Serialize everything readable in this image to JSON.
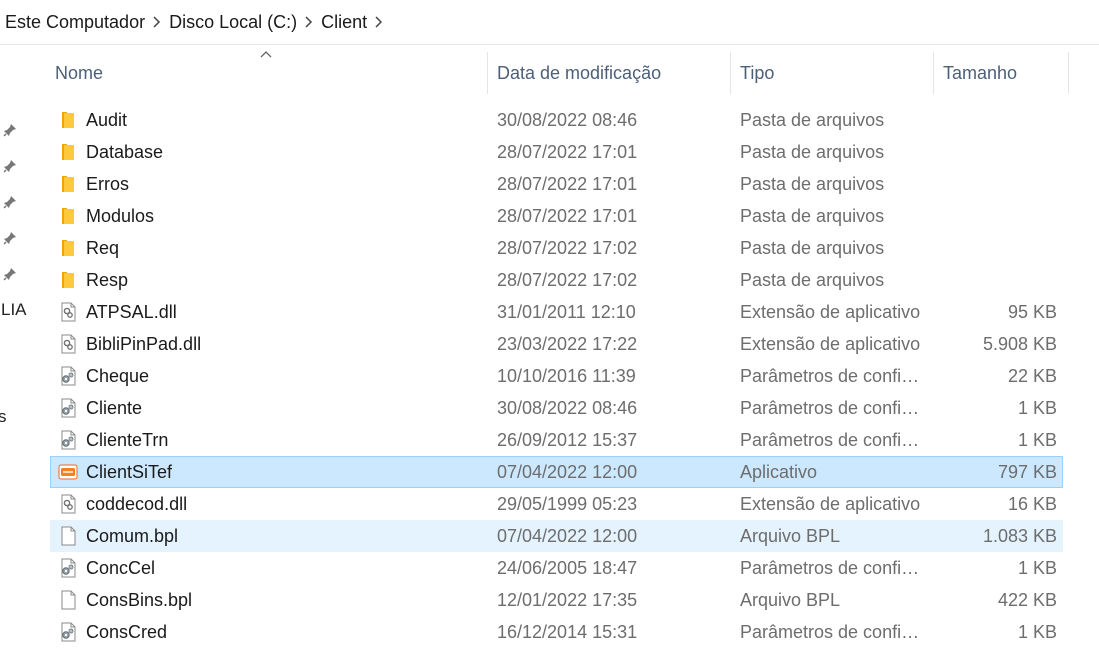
{
  "breadcrumb": [
    "Este Computador",
    "Disco Local (C:)",
    "Client"
  ],
  "left_nav": {
    "labels": [
      "LIA",
      "s"
    ]
  },
  "columns": {
    "name": "Nome",
    "date": "Data de modificação",
    "type": "Tipo",
    "size": "Tamanho"
  },
  "files": [
    {
      "name": "Audit",
      "date": "30/08/2022 08:46",
      "type": "Pasta de arquivos",
      "size": "",
      "icon": "folder-icon"
    },
    {
      "name": "Database",
      "date": "28/07/2022 17:01",
      "type": "Pasta de arquivos",
      "size": "",
      "icon": "folder-icon"
    },
    {
      "name": "Erros",
      "date": "28/07/2022 17:01",
      "type": "Pasta de arquivos",
      "size": "",
      "icon": "folder-icon"
    },
    {
      "name": "Modulos",
      "date": "28/07/2022 17:01",
      "type": "Pasta de arquivos",
      "size": "",
      "icon": "folder-icon"
    },
    {
      "name": "Req",
      "date": "28/07/2022 17:02",
      "type": "Pasta de arquivos",
      "size": "",
      "icon": "folder-icon"
    },
    {
      "name": "Resp",
      "date": "28/07/2022 17:02",
      "type": "Pasta de arquivos",
      "size": "",
      "icon": "folder-icon"
    },
    {
      "name": "ATPSAL.dll",
      "date": "31/01/2011 12:10",
      "type": "Extensão de aplicativo",
      "size": "95 KB",
      "icon": "dll-icon"
    },
    {
      "name": "BibliPinPad.dll",
      "date": "23/03/2022 17:22",
      "type": "Extensão de aplicativo",
      "size": "5.908 KB",
      "icon": "dll-icon"
    },
    {
      "name": "Cheque",
      "date": "10/10/2016 11:39",
      "type": "Parâmetros de config...",
      "size": "22 KB",
      "icon": "config-file-icon"
    },
    {
      "name": "Cliente",
      "date": "30/08/2022 08:46",
      "type": "Parâmetros de config...",
      "size": "1 KB",
      "icon": "config-file-icon"
    },
    {
      "name": "ClienteTrn",
      "date": "26/09/2012 15:37",
      "type": "Parâmetros de config...",
      "size": "1 KB",
      "icon": "config-file-icon"
    },
    {
      "name": "ClientSiTef",
      "date": "07/04/2022 12:00",
      "type": "Aplicativo",
      "size": "797 KB",
      "icon": "sitef-app-icon",
      "state": "selected"
    },
    {
      "name": "coddecod.dll",
      "date": "29/05/1999 05:23",
      "type": "Extensão de aplicativo",
      "size": "16 KB",
      "icon": "dll-icon"
    },
    {
      "name": "Comum.bpl",
      "date": "07/04/2022 12:00",
      "type": "Arquivo BPL",
      "size": "1.083 KB",
      "icon": "blank-file-icon",
      "state": "hover"
    },
    {
      "name": "ConcCel",
      "date": "24/06/2005 18:47",
      "type": "Parâmetros de config...",
      "size": "1 KB",
      "icon": "config-file-icon"
    },
    {
      "name": "ConsBins.bpl",
      "date": "12/01/2022 17:35",
      "type": "Arquivo BPL",
      "size": "422 KB",
      "icon": "blank-file-icon"
    },
    {
      "name": "ConsCred",
      "date": "16/12/2014 15:31",
      "type": "Parâmetros de config...",
      "size": "1 KB",
      "icon": "config-file-icon"
    }
  ],
  "colors": {
    "selected_bg": "#cce8ff",
    "hover_bg": "#e5f3ff",
    "folder": "#ffc83d"
  }
}
